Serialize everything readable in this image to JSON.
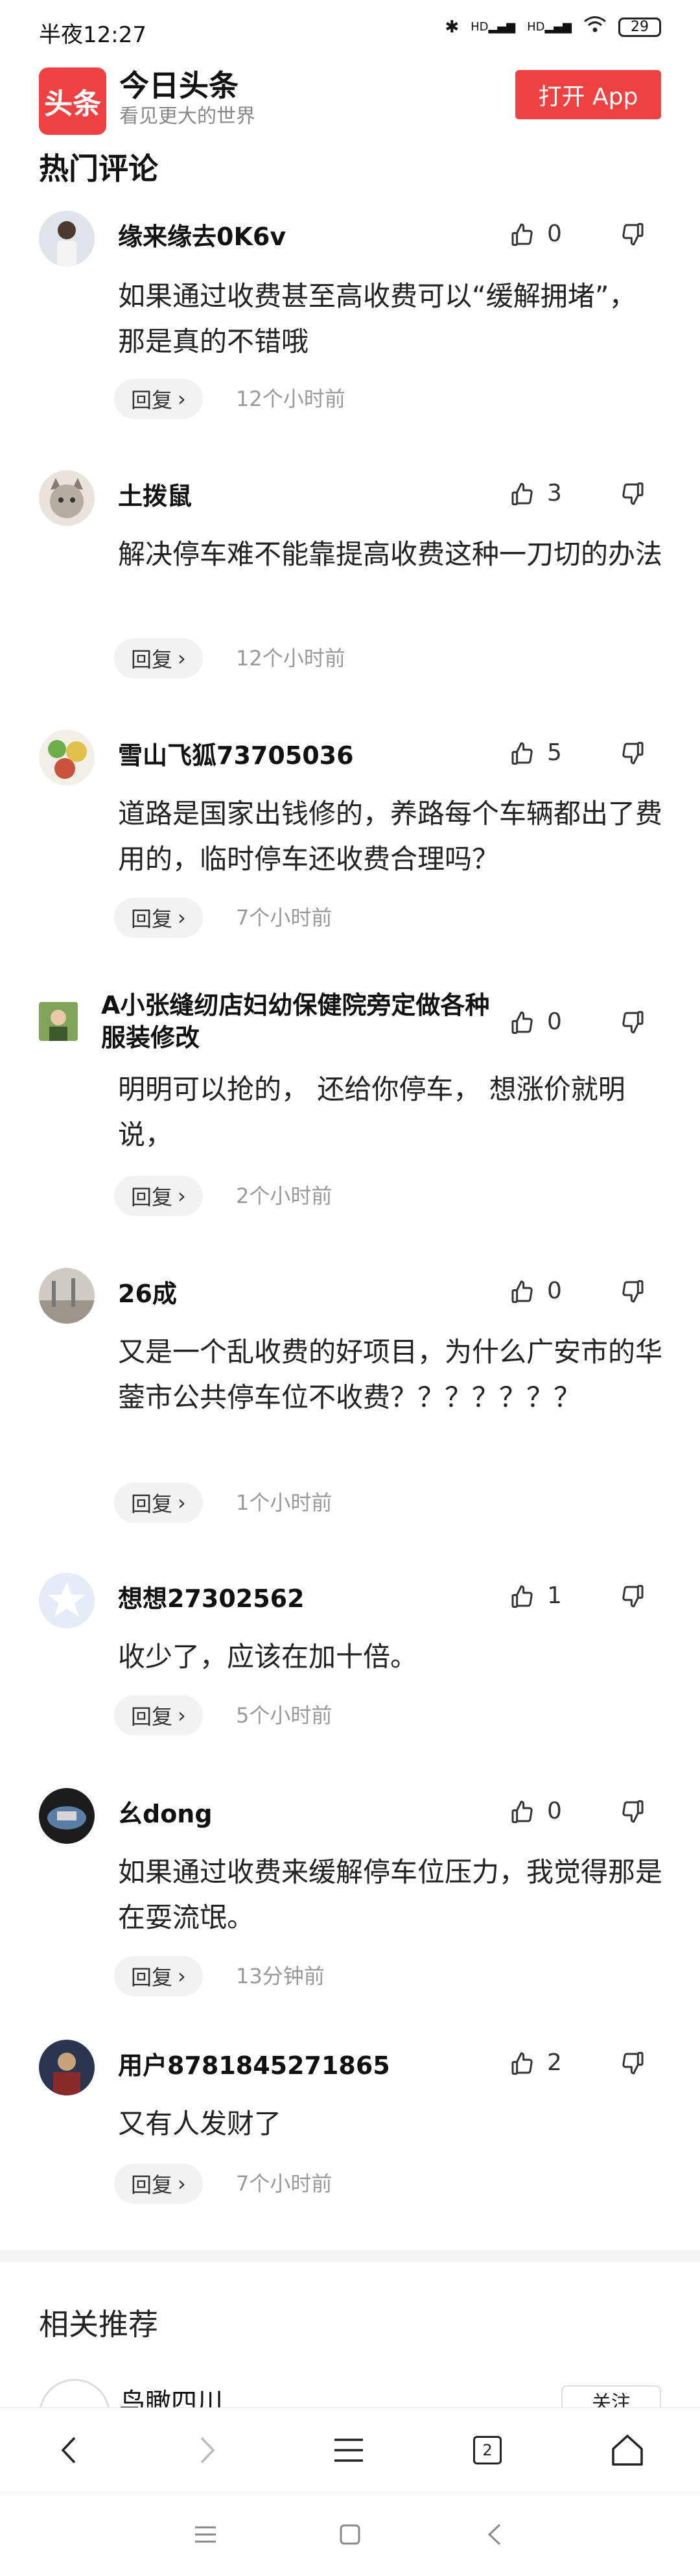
{
  "status": {
    "time": "半夜12:27",
    "battery": "29",
    "signal_labels": [
      "HD",
      "HD"
    ]
  },
  "header": {
    "logo_text": "头条",
    "app_name": "今日头条",
    "slogan": "看见更大的世界",
    "open_app": "打开 App"
  },
  "section_title": "热门评论",
  "comments": [
    {
      "user": "缘来缘去0K6v",
      "likes": "0",
      "text": "如果通过收费甚至高收费可以“缓解拥堵”，那是真的不错哦",
      "reply": "回复",
      "time": "12个小时前"
    },
    {
      "user": "土拨鼠",
      "likes": "3",
      "text": "解决停车难不能靠提高收费这种一刀切的办法",
      "reply": "回复",
      "time": "12个小时前"
    },
    {
      "user": "雪山飞狐73705036",
      "likes": "5",
      "text": "道路是国家出钱修的，养路每个车辆都出了费用的，临时停车还收费合理吗？",
      "reply": "回复",
      "time": "7个小时前"
    },
    {
      "user": "A小张缝纫店妇幼保健院旁定做各种服装修改",
      "likes": "0",
      "text": "明明可以抢的， 还给你停车， 想涨价就明说，",
      "reply": "回复",
      "time": "2个小时前"
    },
    {
      "user": "26成",
      "likes": "0",
      "text": "又是一个乱收费的好项目，为什么广安市的华蓥市公共停车位不收费？？？？？？？",
      "reply": "回复",
      "time": "1个小时前"
    },
    {
      "user": "想想27302562",
      "likes": "1",
      "text": "收少了，应该在加十倍。",
      "reply": "回复",
      "time": "5个小时前"
    },
    {
      "user": "幺dong",
      "likes": "0",
      "text": "如果通过收费来缓解停车位压力，我觉得那是在耍流氓。",
      "reply": "回复",
      "time": "13分钟前"
    },
    {
      "user": "用户8781845271865",
      "likes": "2",
      "text": "又有人发财了",
      "reply": "回复",
      "time": "7个小时前"
    }
  ],
  "related": {
    "title": "相关推荐",
    "first_item_name": "鸟瞰四川",
    "follow_label": "关注"
  },
  "browser": {
    "tab_count": "2"
  }
}
